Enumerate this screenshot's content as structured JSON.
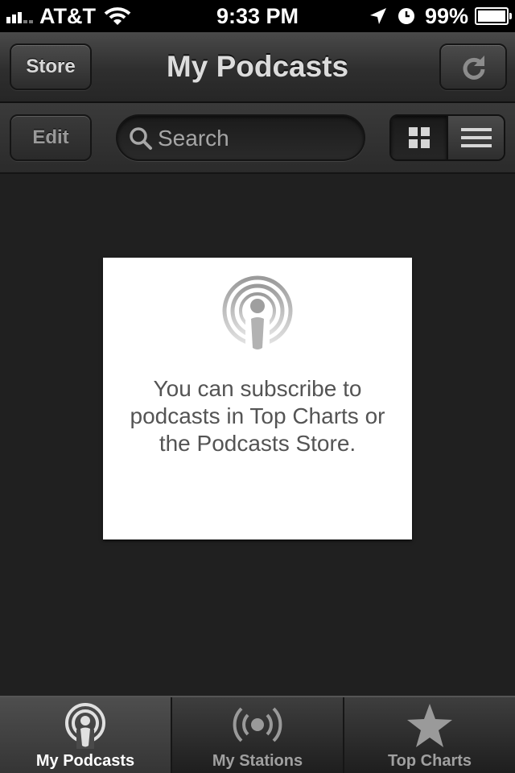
{
  "status_bar": {
    "carrier": "AT&T",
    "time": "9:33 PM",
    "battery_percent": "99%",
    "battery_level": 0.99,
    "icons": [
      "signal-icon",
      "wifi-icon",
      "location-arrow-icon",
      "clock-icon",
      "battery-icon"
    ]
  },
  "nav": {
    "title": "My Podcasts",
    "store_label": "Store",
    "refresh_icon": "refresh-icon"
  },
  "toolbar": {
    "edit_label": "Edit",
    "search_placeholder": "Search",
    "search_value": "",
    "view_modes": [
      "grid-view-icon",
      "list-view-icon"
    ],
    "selected_view": "grid"
  },
  "empty_state": {
    "icon": "podcast-icon",
    "message": "You can subscribe to podcasts in Top Charts or the Podcasts Store."
  },
  "tabs": [
    {
      "label": "My Podcasts",
      "icon": "podcast-icon",
      "active": true
    },
    {
      "label": "My Stations",
      "icon": "stations-icon",
      "active": false
    },
    {
      "label": "Top Charts",
      "icon": "star-icon",
      "active": false
    }
  ],
  "colors": {
    "background": "#202020",
    "card": "#ffffff",
    "card_text": "#545454",
    "active_tab_label": "#ffffff"
  }
}
